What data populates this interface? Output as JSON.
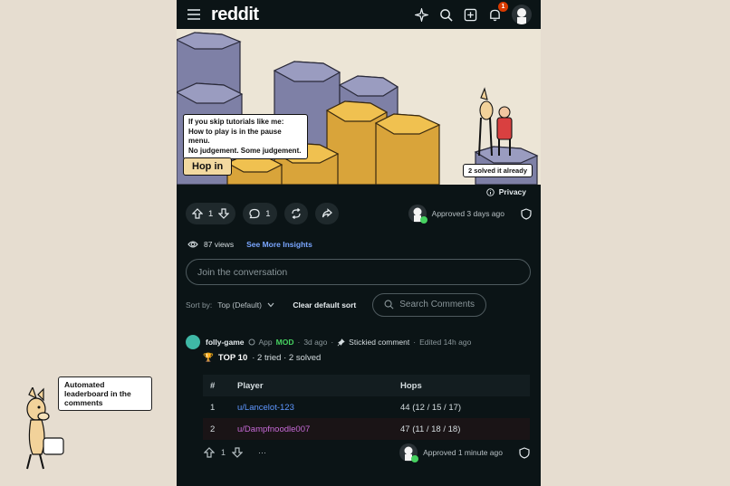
{
  "annotation": {
    "text": "Automated leaderboard in the comments"
  },
  "header": {
    "logo": "reddit",
    "notification_count": "1"
  },
  "banner": {
    "tip_line1": "If you skip tutorials like me:",
    "tip_line2": "How to play is in the pause menu.",
    "tip_line3": "No judgement. Some judgement.",
    "hop_button": "Hop in",
    "solved_badge": "2 solved it already"
  },
  "privacy": "Privacy",
  "post_actions": {
    "votes": "1",
    "comments": "1",
    "approved": "Approved 3 days ago"
  },
  "insights": {
    "views": "87 views",
    "see_more": "See More Insights"
  },
  "join_placeholder": "Join the conversation",
  "sort": {
    "label": "Sort by:",
    "value": "Top (Default)",
    "clear": "Clear default sort",
    "search": "Search Comments"
  },
  "comment": {
    "username": "folly-game",
    "app_tag": "App",
    "mod_tag": "MOD",
    "age": "3d ago",
    "stickied": "Stickied comment",
    "edited": "Edited 14h ago",
    "summary_title": "TOP 10",
    "summary_rest": "· 2 tried · 2 solved",
    "votes": "1",
    "more": "···",
    "approved": "Approved 1 minute ago"
  },
  "leaderboard": {
    "headers": [
      "#",
      "Player",
      "Hops"
    ],
    "rows": [
      {
        "rank": "1",
        "player": "u/Lancelot-123",
        "hops": "44 (12 / 15 / 17)"
      },
      {
        "rank": "2",
        "player": "u/Dampfnoodle007",
        "hops": "47 (11 / 18 / 18)"
      }
    ]
  }
}
